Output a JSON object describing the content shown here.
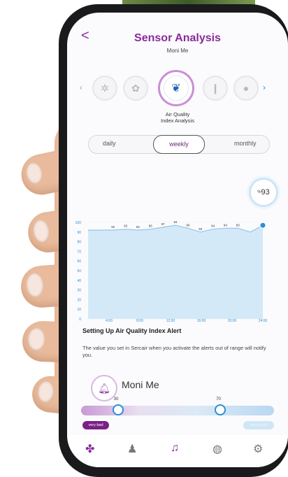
{
  "header": {
    "back_label": "<",
    "title": "Sensor Analysis",
    "subtitle": "Moni Me"
  },
  "sensors": {
    "selected_label_line1": "Air Quality",
    "selected_label_line2": "Index Analysis",
    "icons": [
      "bacteria-icon",
      "fan-icon",
      "leaf-icon",
      "thermometer-icon",
      "droplet-icon"
    ]
  },
  "tabs": {
    "daily": "daily",
    "weekly": "weekly",
    "monthly": "monthly"
  },
  "badge": {
    "prefix": "%",
    "value": "93"
  },
  "chart_data": {
    "type": "area",
    "x": [
      1,
      2,
      3,
      4,
      5,
      6,
      7,
      8,
      9,
      10,
      11,
      12,
      13,
      14,
      15
    ],
    "values": [
      92,
      92,
      92,
      93,
      92,
      93,
      95,
      97,
      94,
      90,
      93,
      94,
      94,
      90,
      97
    ],
    "data_labels": [
      "92",
      "93",
      "92",
      "95",
      "97",
      "94",
      "90",
      "93",
      "94",
      "94",
      "93"
    ],
    "x_tick_labels": [
      "4:00",
      "8:00",
      "12:00",
      "16:00",
      "20:00",
      "24:00"
    ],
    "y_tick_labels": [
      "0",
      "10",
      "20",
      "30",
      "40",
      "50",
      "60",
      "70",
      "80",
      "90",
      "100"
    ],
    "ylim": [
      0,
      100
    ],
    "grid": true,
    "colors": {
      "line": "#8ec6ea",
      "fill": "#d4e9f7",
      "end_point": "#2b8fd8"
    }
  },
  "alert": {
    "title": "Setting Up Air Quality Index Alert",
    "description": "The value you set in Sercair when you activate the alerts out of range will notify you.",
    "device_name": "Moni Me"
  },
  "range": {
    "low_value": 30,
    "high_value": 70,
    "low_label": "30",
    "high_label": "70",
    "left_pill": "very bad",
    "right_pill": "very good"
  },
  "nav": [
    "grid-icon",
    "users-icon",
    "bell-notification-icon",
    "globe-icon",
    "settings-icon"
  ],
  "colors": {
    "accent": "#8a2a9a",
    "blue": "#2b8fd8"
  }
}
